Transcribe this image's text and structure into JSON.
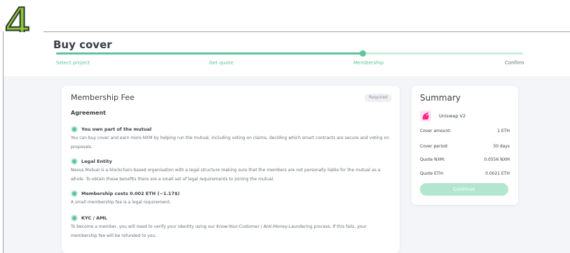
{
  "overlay": {
    "step_number": "4"
  },
  "header": {
    "title": "Buy cover",
    "progress": 0.66,
    "steps": [
      {
        "label": "Select project"
      },
      {
        "label": "Get quote"
      },
      {
        "label": "Membership"
      },
      {
        "label": "Confirm"
      }
    ]
  },
  "membership": {
    "title": "Membership Fee",
    "badge": "Required",
    "agreement": "Agreement",
    "items": [
      {
        "title": "You own part of the mutual",
        "desc": "You can buy cover and earn more NXM by helping run the mutual, including voting on claims, deciding which smart contracts are secure and voting on proposals."
      },
      {
        "title": "Legal Entity",
        "desc": "Nexus Mutual is a blockchain-based organisation with a legal structure making sure that the members are not personally liable for the mutual as a whole. To obtain these benefits there are a small set of legal requirements to joining the mutual."
      },
      {
        "title": "Membership costs 0.002 ETH (~1.17$)",
        "desc": "A small membership fee is a legal requirement."
      },
      {
        "title": "KYC / AML",
        "desc": "To become a member, you will need to verify your identity using our Know-Your-Customer / Anti-Money-Laundering process. If this fails, your membership fee will be refunded to you."
      }
    ]
  },
  "summary": {
    "title": "Summary",
    "product": {
      "name": "Uniswap V2",
      "icon": "unicorn-icon"
    },
    "rows": [
      {
        "label": "Cover amount:",
        "value": "1 ETH"
      },
      {
        "label": "Cover period:",
        "value": "30 days"
      },
      {
        "label": "Quote NXM:",
        "value": "0.0556 NXM"
      },
      {
        "label": "Quote ETH:",
        "value": "0.0021 ETH"
      }
    ],
    "continue_label": "Continue"
  },
  "colors": {
    "accent": "#5cc59a",
    "accent_light": "#cdebdd",
    "button_disabled": "#b3e6cf",
    "overlay_number": "#8cc63f"
  }
}
